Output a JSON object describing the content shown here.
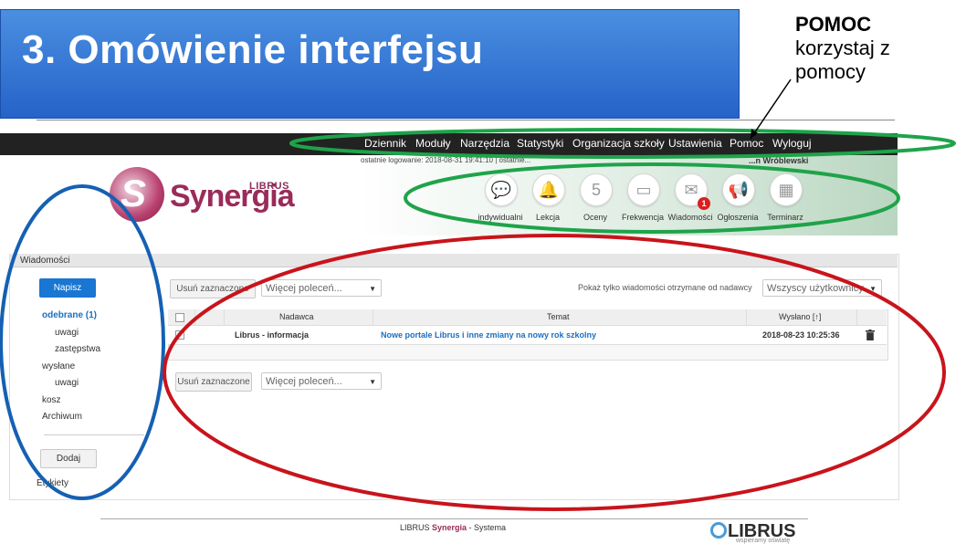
{
  "slide": {
    "title": "3. Omówienie interfejsu",
    "help_title": "POMOC",
    "help_line1": "korzystaj z",
    "help_line2": "pomocy"
  },
  "navbar": {
    "items": [
      "Dziennik",
      "Moduły",
      "Narzędzia",
      "Statystyki",
      "Organizacja szkoły",
      "Ustawienia",
      "Pomoc",
      "Wyloguj"
    ]
  },
  "header": {
    "last_login": "ostatnie logowanie: 2018-08-31 19:41:10  |  ostatnie...",
    "user": "...n Wróblewski",
    "logo_small": "LIBRUS",
    "logo_main": "Synergia"
  },
  "top_icons": [
    {
      "label": "indywidualni",
      "icon": "chat-icon",
      "glyph": "💬"
    },
    {
      "label": "Lekcja",
      "icon": "bell-icon",
      "glyph": "🔔"
    },
    {
      "label": "Oceny",
      "icon": "grade-icon",
      "glyph": "5"
    },
    {
      "label": "Frekwencja",
      "icon": "attendance-icon",
      "glyph": "▭"
    },
    {
      "label": "Wiadomości",
      "icon": "mail-icon",
      "glyph": "✉"
    },
    {
      "label": "Ogłoszenia",
      "icon": "megaphone-icon",
      "glyph": "📢"
    },
    {
      "label": "Terminarz",
      "icon": "calendar-icon",
      "glyph": "▦"
    }
  ],
  "messages_badge": "1",
  "panel": {
    "title": "Wiadomości",
    "compose": "Napisz",
    "sidebar": {
      "inbox": "odebrane (1)",
      "inbox_sub1": "uwagi",
      "inbox_sub2": "zastępstwa",
      "sent": "wysłane",
      "sent_sub1": "uwagi",
      "trash": "kosz",
      "archive": "Archiwum",
      "add": "Dodaj",
      "labels": "Etykiety"
    },
    "toolbar": {
      "delete_selected": "Usuń zaznaczone",
      "more_commands": "Więcej poleceń...",
      "filter_label": "Pokaż tylko wiadomości otrzymane od nadawcy",
      "filter_value": "Wszyscy użytkownicy"
    },
    "table": {
      "headers": [
        "Nadawca",
        "Temat",
        "Wysłano [↑]"
      ],
      "rows": [
        {
          "sender": "Librus - informacja",
          "subject": "Nowe portale Librus i inne zmiany na nowy rok szkolny",
          "date": "2018-08-23 10:25:36"
        }
      ]
    }
  },
  "footer": {
    "text_a": "LIBRUS ",
    "text_b": "Synergia",
    "text_c": " - Systema",
    "logo": "LIBRUS",
    "slogan": "wspieramy oświatę"
  },
  "annotation_colors": {
    "green": "#1fa34a",
    "red": "#c8141b",
    "blue": "#1560b3"
  }
}
